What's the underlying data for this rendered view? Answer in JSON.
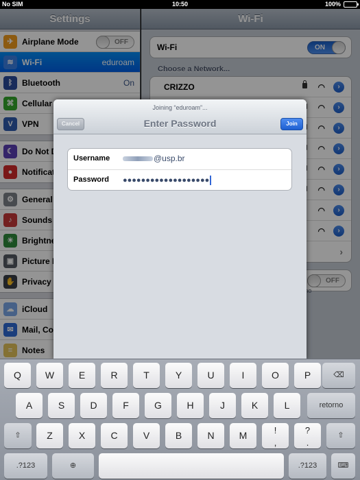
{
  "status": {
    "carrier": "No SIM",
    "time": "10:50",
    "battery": "100%",
    "battery_level": 1.0
  },
  "settings": {
    "title": "Settings",
    "groups": [
      [
        {
          "label": "Airplane Mode",
          "toggle": "OFF",
          "icon_color": "#f29b1d",
          "icon": "✈"
        },
        {
          "label": "Wi-Fi",
          "value": "eduroam",
          "icon_color": "#3a80e6",
          "icon": "≋",
          "selected": true
        },
        {
          "label": "Bluetooth",
          "value": "On",
          "icon_color": "#2a4b9c",
          "icon": "ᛒ"
        },
        {
          "label": "Cellular",
          "icon_color": "#34a72c",
          "icon": "⌘"
        },
        {
          "label": "VPN",
          "icon_color": "#2f5caf",
          "icon": "V"
        }
      ],
      [
        {
          "label": "Do Not D",
          "icon_color": "#5b3fb5",
          "icon": "☾"
        },
        {
          "label": "Notificat",
          "icon_color": "#d22a2a",
          "icon": "●"
        }
      ],
      [
        {
          "label": "General",
          "icon_color": "#7d8189",
          "icon": "⚙"
        },
        {
          "label": "Sounds",
          "icon_color": "#c63a3a",
          "icon": "♪"
        },
        {
          "label": "Brightne",
          "icon_color": "#2f8a3c",
          "icon": "☀"
        },
        {
          "label": "Picture F",
          "icon_color": "#555a63",
          "icon": "▣"
        },
        {
          "label": "Privacy",
          "icon_color": "#3a3f48",
          "icon": "✋"
        }
      ],
      [
        {
          "label": "iCloud",
          "icon_color": "#7aa8e8",
          "icon": "☁"
        },
        {
          "label": "Mail, Co",
          "icon_color": "#2f6bd6",
          "icon": "✉"
        },
        {
          "label": "Notes",
          "icon_color": "#e3c35a",
          "icon": "≡"
        }
      ]
    ]
  },
  "wifi_pane": {
    "title": "Wi-Fi",
    "wifi_label": "Wi-Fi",
    "wifi_toggle": "ON",
    "choose_label": "Choose a Network...",
    "networks": [
      "CRIZZO",
      "",
      "",
      "",
      "",
      "",
      "",
      ""
    ],
    "ask_toggle": "OFF",
    "note_fragment": "y. If no\nve to"
  },
  "dialog": {
    "subtitle": "Joining “eduroam”...",
    "title": "Enter Password",
    "cancel": "Cancel",
    "join": "Join",
    "username_label": "Username",
    "username_value": "@usp.br",
    "password_label": "Password",
    "password_value": "●●●●●●●●●●●●●●●●●●●"
  },
  "keyboard": {
    "row1": [
      "Q",
      "W",
      "E",
      "R",
      "T",
      "Y",
      "U",
      "I",
      "O",
      "P"
    ],
    "row2": [
      "A",
      "S",
      "D",
      "F",
      "G",
      "H",
      "J",
      "K",
      "L"
    ],
    "row3": [
      "Z",
      "X",
      "C",
      "V",
      "B",
      "N",
      "M"
    ],
    "return": "retorno",
    "numbers": ".?123",
    "excl": "!\n,",
    "quest": "?\n."
  }
}
